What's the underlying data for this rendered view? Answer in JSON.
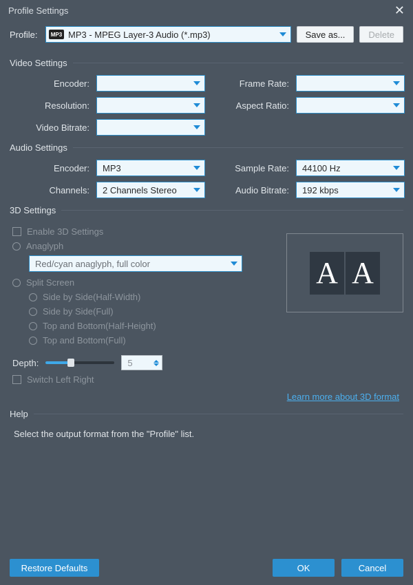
{
  "window": {
    "title": "Profile Settings"
  },
  "profile": {
    "label": "Profile:",
    "value": "MP3 - MPEG Layer-3 Audio (*.mp3)",
    "saveAs": "Save as...",
    "delete": "Delete"
  },
  "video": {
    "header": "Video Settings",
    "encoderLabel": "Encoder:",
    "encoderValue": "",
    "resolutionLabel": "Resolution:",
    "resolutionValue": "",
    "bitrateLabel": "Video Bitrate:",
    "bitrateValue": "",
    "frameRateLabel": "Frame Rate:",
    "frameRateValue": "",
    "aspectLabel": "Aspect Ratio:",
    "aspectValue": ""
  },
  "audio": {
    "header": "Audio Settings",
    "encoderLabel": "Encoder:",
    "encoderValue": "MP3",
    "channelsLabel": "Channels:",
    "channelsValue": "2 Channels Stereo",
    "sampleRateLabel": "Sample Rate:",
    "sampleRateValue": "44100 Hz",
    "bitrateLabel": "Audio Bitrate:",
    "bitrateValue": "192 kbps"
  },
  "threeD": {
    "header": "3D Settings",
    "enableLabel": "Enable 3D Settings",
    "anaglyphLabel": "Anaglyph",
    "anaglyphValue": "Red/cyan anaglyph, full color",
    "splitLabel": "Split Screen",
    "sbsHalf": "Side by Side(Half-Width)",
    "sbsFull": "Side by Side(Full)",
    "tabHalf": "Top and Bottom(Half-Height)",
    "tabFull": "Top and Bottom(Full)",
    "depthLabel": "Depth:",
    "depthValue": "5",
    "switchLabel": "Switch Left Right",
    "learnMore": "Learn more about 3D format",
    "previewA": "A",
    "previewB": "A"
  },
  "help": {
    "header": "Help",
    "text": "Select the output format from the \"Profile\" list."
  },
  "footer": {
    "restore": "Restore Defaults",
    "ok": "OK",
    "cancel": "Cancel"
  }
}
